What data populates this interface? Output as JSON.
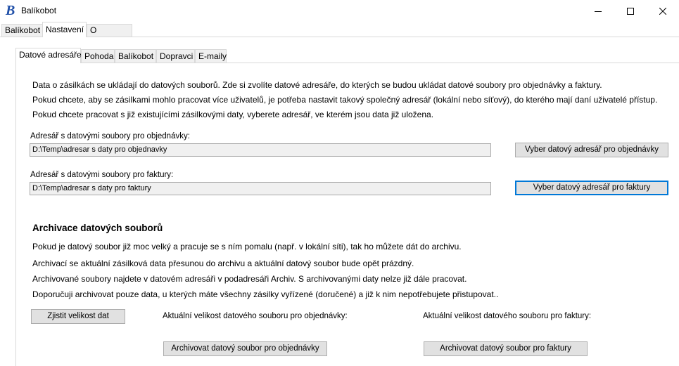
{
  "window": {
    "title": "Balíkobot",
    "logo_glyph": "B",
    "icons": [
      "minimize-icon",
      "maximize-icon",
      "close-icon"
    ]
  },
  "main_tabs": [
    {
      "label": "Balíkobot"
    },
    {
      "label": "Nastavení"
    },
    {
      "label": "O programu"
    }
  ],
  "sub_tabs": [
    {
      "label": "Datové adresáře"
    },
    {
      "label": "Pohoda"
    },
    {
      "label": "Balíkobot"
    },
    {
      "label": "Dopravci"
    },
    {
      "label": "E-maily"
    }
  ],
  "intro": {
    "line1": "Data o zásilkách se ukládají do datových souborů. Zde si zvolíte datové adresáře, do kterých se budou ukládat datové soubory pro objednávky a faktury.",
    "line2": "Pokud chcete, aby se zásilkami mohlo pracovat více uživatelů, je potřeba nastavit takový společný adresář (lokální nebo síťový), do kterého mají daní uživatelé přístup.",
    "line3": "Pokud chcete pracovat s již existujícími zásilkovými daty, vyberete adresář, ve kterém jsou data již uložena."
  },
  "orders_dir": {
    "label": "Adresář s datovými soubory pro objednávky:",
    "value": "D:\\Temp\\adresar s daty pro objednavky",
    "button": "Vyber datový adresář pro objednávky"
  },
  "invoices_dir": {
    "label": "Adresář s datovými soubory pro faktury:",
    "value": "D:\\Temp\\adresar s daty pro faktury",
    "button": "Vyber datový adresář pro faktury"
  },
  "archive": {
    "heading": "Archivace datových souborů",
    "line1": "Pokud je datový soubor již moc velký a pracuje se s ním pomalu (např. v lokální síti), tak ho můžete dát do archivu.",
    "line2": "Archivací se aktuální zásilková data přesunou do archivu a aktuální datový soubor bude opět prázdný.",
    "line3": "Archivované soubory najdete v datovém adresáři v podadresáři Archiv. S archivovanými daty nelze již dále pracovat.",
    "line4": "Doporučuji archivovat pouze data, u kterých máte všechny zásilky vyřízené (doručené) a již k nim nepotřebujete přistupovat..",
    "size_button": "Zjistit velikost dat",
    "orders_size_label": "Aktuální velikost datového souboru pro objednávky:",
    "invoices_size_label": "Aktuální velikost datového souboru pro faktury:",
    "archive_orders_button": "Archivovat datový soubor pro objednávky",
    "archive_invoices_button": "Archivovat datový soubor pro faktury"
  }
}
